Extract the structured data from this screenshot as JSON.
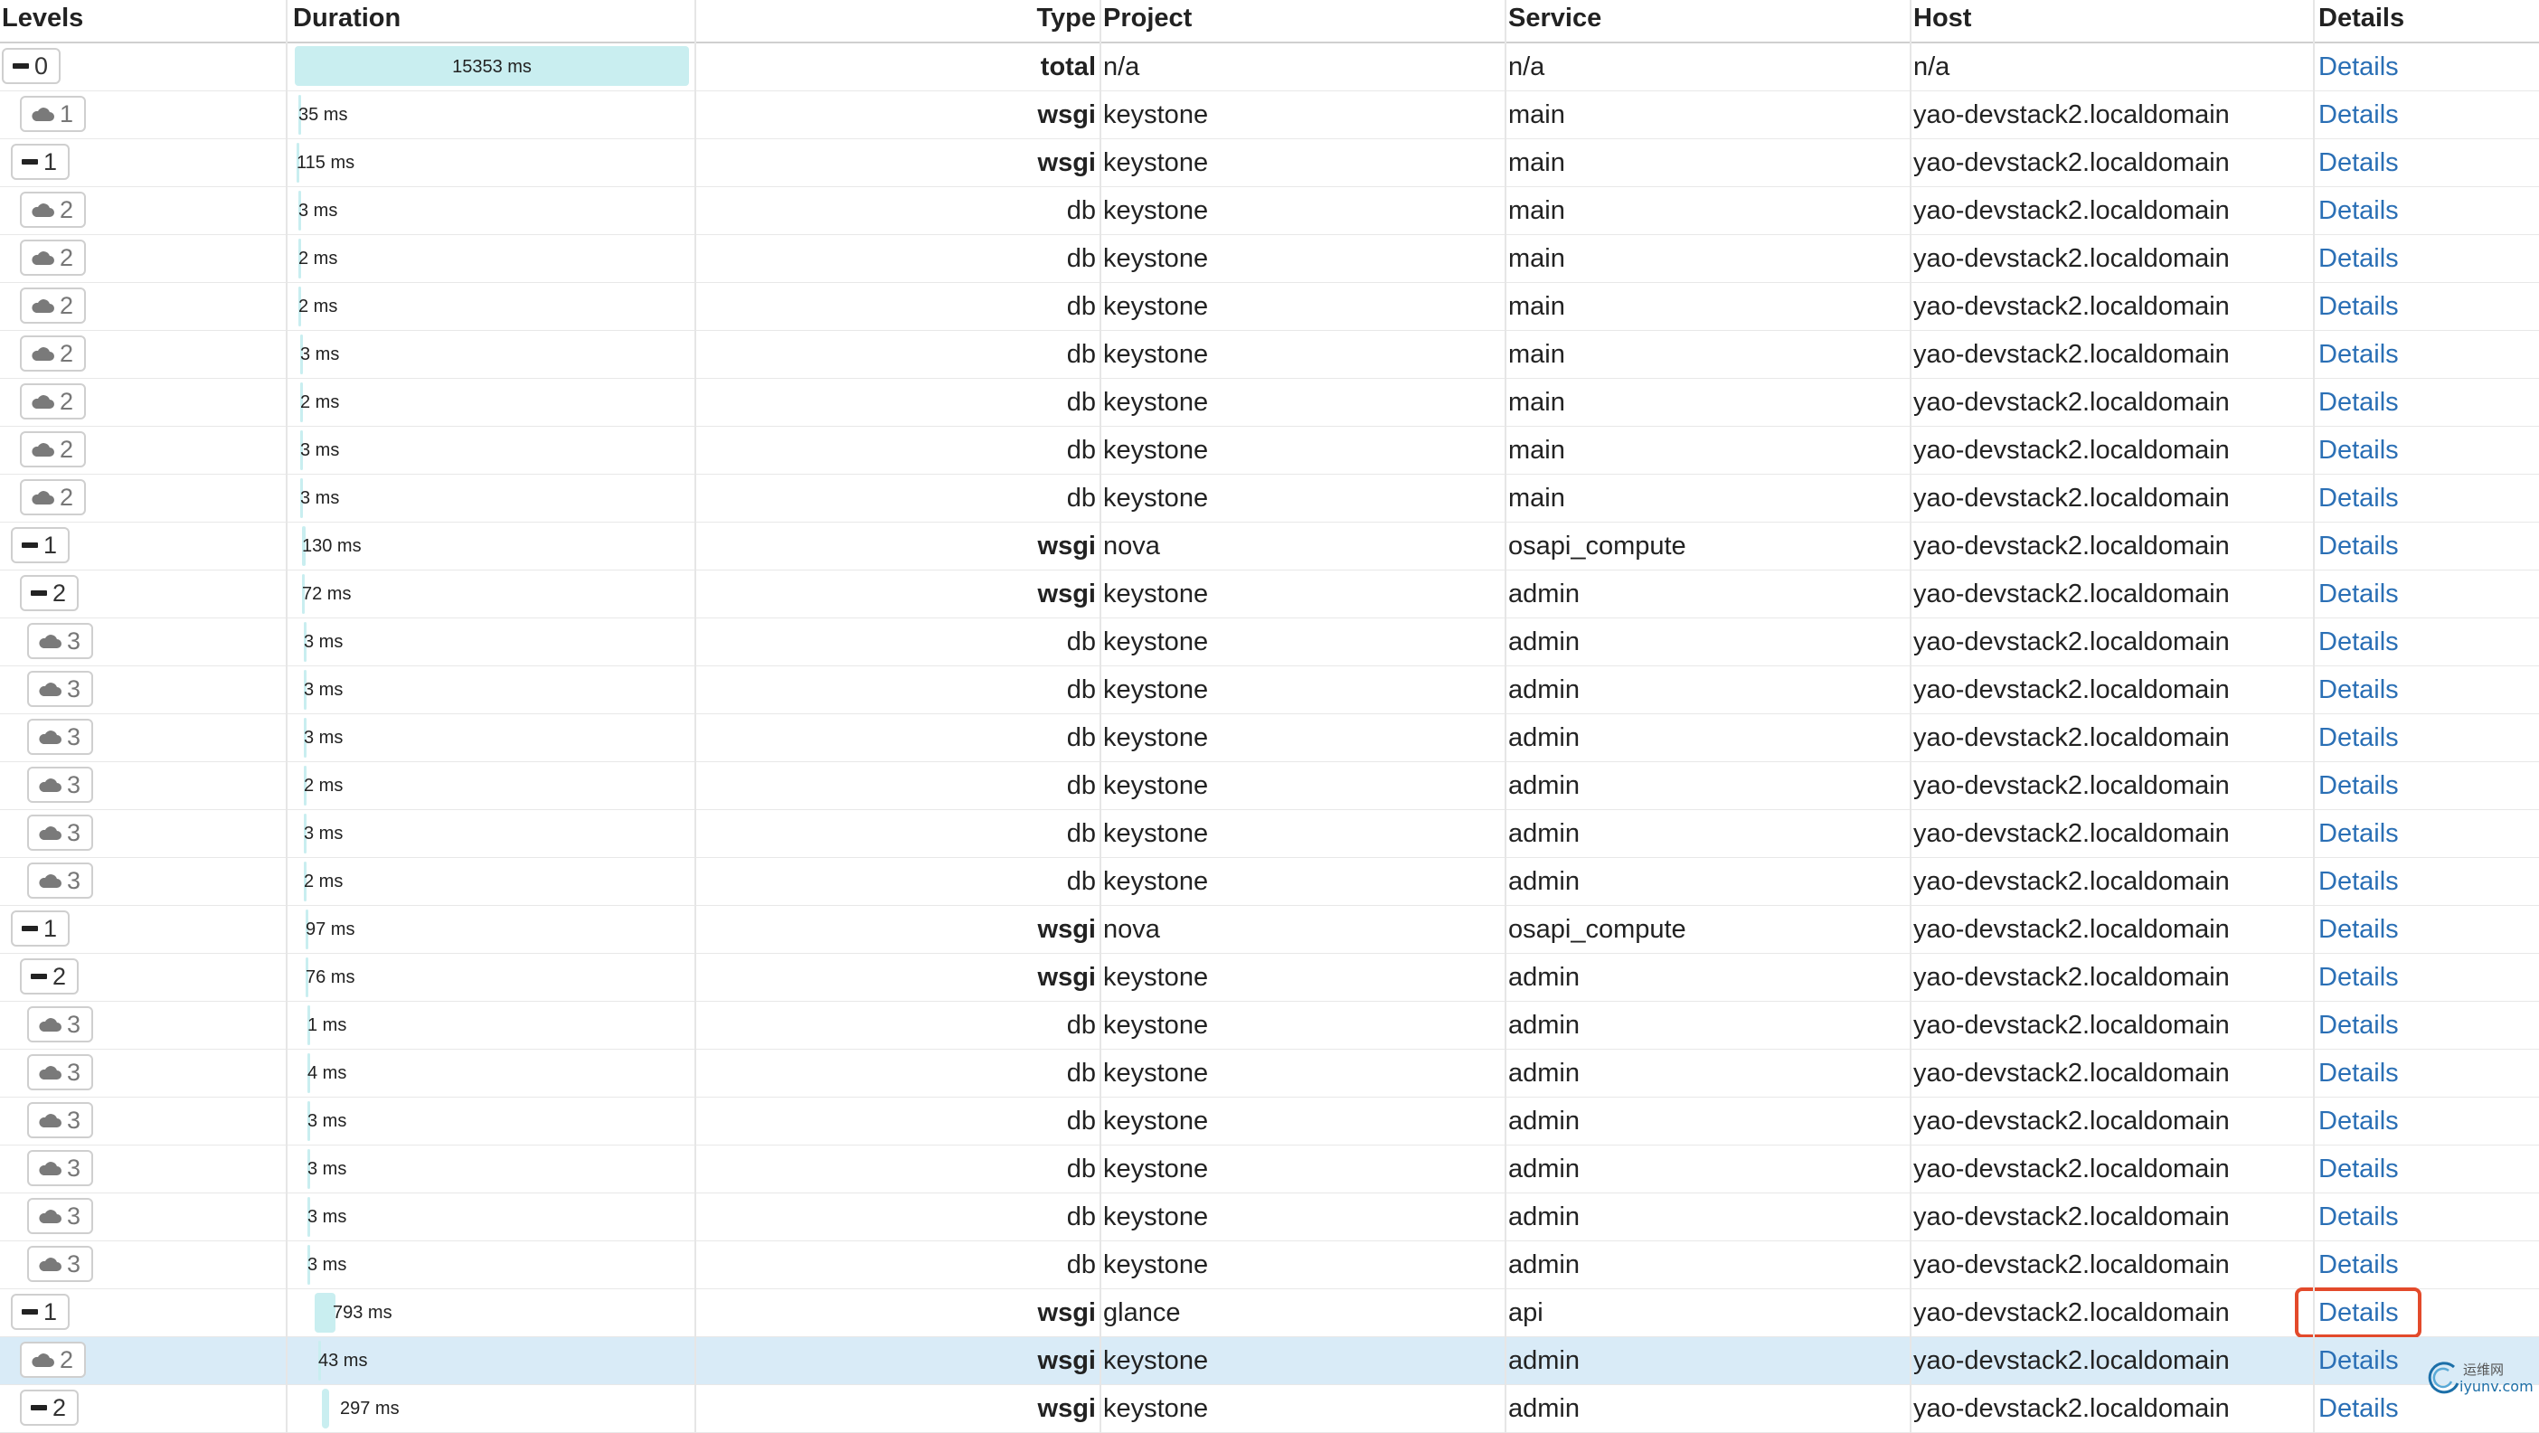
{
  "columns": {
    "levels": "Levels",
    "duration": "Duration",
    "type": "Type",
    "project": "Project",
    "service": "Service",
    "host": "Host",
    "details": "Details"
  },
  "colors": {
    "bar": "#c9eef0",
    "link": "#2a6fb5",
    "highlight_row": "#d9ebf7",
    "callout": "#e34a2b"
  },
  "total_duration_ms": 15353,
  "rows": [
    {
      "level": "0",
      "icon": "minus-icon",
      "duration": "15353 ms",
      "type": "total",
      "project": "n/a",
      "service": "n/a",
      "host": "n/a",
      "details": "Details"
    },
    {
      "level": "1",
      "icon": "cloud-icon",
      "duration": "35 ms",
      "type": "wsgi",
      "project": "keystone",
      "service": "main",
      "host": "yao-devstack2.localdomain",
      "details": "Details"
    },
    {
      "level": "1",
      "icon": "minus-icon",
      "duration": "115 ms",
      "type": "wsgi",
      "project": "keystone",
      "service": "main",
      "host": "yao-devstack2.localdomain",
      "details": "Details"
    },
    {
      "level": "2",
      "icon": "cloud-icon",
      "duration": "3 ms",
      "type": "db",
      "project": "keystone",
      "service": "main",
      "host": "yao-devstack2.localdomain",
      "details": "Details"
    },
    {
      "level": "2",
      "icon": "cloud-icon",
      "duration": "2 ms",
      "type": "db",
      "project": "keystone",
      "service": "main",
      "host": "yao-devstack2.localdomain",
      "details": "Details"
    },
    {
      "level": "2",
      "icon": "cloud-icon",
      "duration": "2 ms",
      "type": "db",
      "project": "keystone",
      "service": "main",
      "host": "yao-devstack2.localdomain",
      "details": "Details"
    },
    {
      "level": "2",
      "icon": "cloud-icon",
      "duration": "3 ms",
      "type": "db",
      "project": "keystone",
      "service": "main",
      "host": "yao-devstack2.localdomain",
      "details": "Details"
    },
    {
      "level": "2",
      "icon": "cloud-icon",
      "duration": "2 ms",
      "type": "db",
      "project": "keystone",
      "service": "main",
      "host": "yao-devstack2.localdomain",
      "details": "Details"
    },
    {
      "level": "2",
      "icon": "cloud-icon",
      "duration": "3 ms",
      "type": "db",
      "project": "keystone",
      "service": "main",
      "host": "yao-devstack2.localdomain",
      "details": "Details"
    },
    {
      "level": "2",
      "icon": "cloud-icon",
      "duration": "3 ms",
      "type": "db",
      "project": "keystone",
      "service": "main",
      "host": "yao-devstack2.localdomain",
      "details": "Details"
    },
    {
      "level": "1",
      "icon": "minus-icon",
      "duration": "130 ms",
      "type": "wsgi",
      "project": "nova",
      "service": "osapi_compute",
      "host": "yao-devstack2.localdomain",
      "details": "Details"
    },
    {
      "level": "2",
      "icon": "minus-icon",
      "duration": "72 ms",
      "type": "wsgi",
      "project": "keystone",
      "service": "admin",
      "host": "yao-devstack2.localdomain",
      "details": "Details"
    },
    {
      "level": "3",
      "icon": "cloud-icon",
      "duration": "3 ms",
      "type": "db",
      "project": "keystone",
      "service": "admin",
      "host": "yao-devstack2.localdomain",
      "details": "Details"
    },
    {
      "level": "3",
      "icon": "cloud-icon",
      "duration": "3 ms",
      "type": "db",
      "project": "keystone",
      "service": "admin",
      "host": "yao-devstack2.localdomain",
      "details": "Details"
    },
    {
      "level": "3",
      "icon": "cloud-icon",
      "duration": "3 ms",
      "type": "db",
      "project": "keystone",
      "service": "admin",
      "host": "yao-devstack2.localdomain",
      "details": "Details"
    },
    {
      "level": "3",
      "icon": "cloud-icon",
      "duration": "2 ms",
      "type": "db",
      "project": "keystone",
      "service": "admin",
      "host": "yao-devstack2.localdomain",
      "details": "Details"
    },
    {
      "level": "3",
      "icon": "cloud-icon",
      "duration": "3 ms",
      "type": "db",
      "project": "keystone",
      "service": "admin",
      "host": "yao-devstack2.localdomain",
      "details": "Details"
    },
    {
      "level": "3",
      "icon": "cloud-icon",
      "duration": "2 ms",
      "type": "db",
      "project": "keystone",
      "service": "admin",
      "host": "yao-devstack2.localdomain",
      "details": "Details"
    },
    {
      "level": "1",
      "icon": "minus-icon",
      "duration": "97 ms",
      "type": "wsgi",
      "project": "nova",
      "service": "osapi_compute",
      "host": "yao-devstack2.localdomain",
      "details": "Details"
    },
    {
      "level": "2",
      "icon": "minus-icon",
      "duration": "76 ms",
      "type": "wsgi",
      "project": "keystone",
      "service": "admin",
      "host": "yao-devstack2.localdomain",
      "details": "Details"
    },
    {
      "level": "3",
      "icon": "cloud-icon",
      "duration": "1 ms",
      "type": "db",
      "project": "keystone",
      "service": "admin",
      "host": "yao-devstack2.localdomain",
      "details": "Details"
    },
    {
      "level": "3",
      "icon": "cloud-icon",
      "duration": "4 ms",
      "type": "db",
      "project": "keystone",
      "service": "admin",
      "host": "yao-devstack2.localdomain",
      "details": "Details"
    },
    {
      "level": "3",
      "icon": "cloud-icon",
      "duration": "3 ms",
      "type": "db",
      "project": "keystone",
      "service": "admin",
      "host": "yao-devstack2.localdomain",
      "details": "Details"
    },
    {
      "level": "3",
      "icon": "cloud-icon",
      "duration": "3 ms",
      "type": "db",
      "project": "keystone",
      "service": "admin",
      "host": "yao-devstack2.localdomain",
      "details": "Details"
    },
    {
      "level": "3",
      "icon": "cloud-icon",
      "duration": "3 ms",
      "type": "db",
      "project": "keystone",
      "service": "admin",
      "host": "yao-devstack2.localdomain",
      "details": "Details"
    },
    {
      "level": "3",
      "icon": "cloud-icon",
      "duration": "3 ms",
      "type": "db",
      "project": "keystone",
      "service": "admin",
      "host": "yao-devstack2.localdomain",
      "details": "Details"
    },
    {
      "level": "1",
      "icon": "minus-icon",
      "duration": "793 ms",
      "type": "wsgi",
      "project": "glance",
      "service": "api",
      "host": "yao-devstack2.localdomain",
      "details": "Details",
      "callout": true
    },
    {
      "level": "2",
      "icon": "cloud-icon",
      "duration": "43 ms",
      "type": "wsgi",
      "project": "keystone",
      "service": "admin",
      "host": "yao-devstack2.localdomain",
      "details": "Details",
      "highlight": true
    },
    {
      "level": "2",
      "icon": "minus-icon",
      "duration": "297 ms",
      "type": "wsgi",
      "project": "keystone",
      "service": "admin",
      "host": "yao-devstack2.localdomain",
      "details": "Details"
    }
  ],
  "watermark": {
    "cn": "运维网",
    "url": "iyunv.com"
  }
}
